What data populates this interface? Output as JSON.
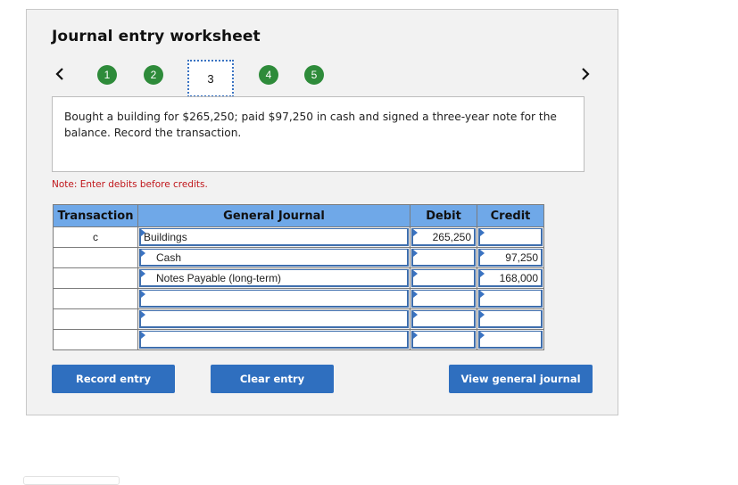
{
  "worksheet": {
    "title": "Journal entry worksheet",
    "steps": [
      {
        "label": "1",
        "state": "complete"
      },
      {
        "label": "2",
        "state": "complete"
      },
      {
        "label": "3",
        "state": "current"
      },
      {
        "label": "4",
        "state": "complete"
      },
      {
        "label": "5",
        "state": "complete"
      }
    ],
    "prev_icon": "chevron-left-icon",
    "next_icon": "chevron-right-icon",
    "prompt": "Bought a building for $265,250; paid $97,250 in cash and signed a three-year note for the balance. Record the transaction.",
    "note": "Note: Enter debits before credits."
  },
  "journal": {
    "headers": {
      "transaction": "Transaction",
      "general_journal": "General Journal",
      "debit": "Debit",
      "credit": "Credit"
    },
    "rows": [
      {
        "transaction": "c",
        "account": "Buildings",
        "debit": "265,250",
        "credit": ""
      },
      {
        "transaction": "",
        "account": "Cash",
        "debit": "",
        "credit": "97,250"
      },
      {
        "transaction": "",
        "account": "Notes Payable (long-term)",
        "debit": "",
        "credit": "168,000"
      },
      {
        "transaction": "",
        "account": "",
        "debit": "",
        "credit": ""
      },
      {
        "transaction": "",
        "account": "",
        "debit": "",
        "credit": ""
      },
      {
        "transaction": "",
        "account": "",
        "debit": "",
        "credit": ""
      }
    ]
  },
  "buttons": {
    "record": "Record entry",
    "clear": "Clear entry",
    "view": "View general journal"
  },
  "colors": {
    "step_complete": "#2e8b3a",
    "header_bg": "#6fa8e8",
    "button_bg": "#2f6fbf",
    "note_text": "#c0161b"
  }
}
